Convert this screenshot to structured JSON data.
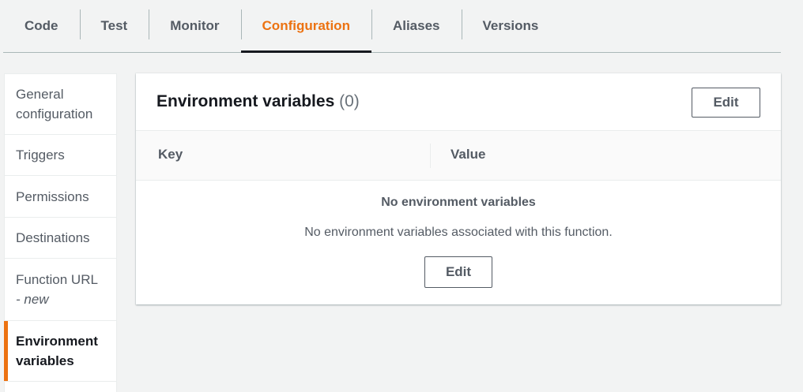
{
  "tabs": [
    {
      "label": "Code"
    },
    {
      "label": "Test"
    },
    {
      "label": "Monitor"
    },
    {
      "label": "Configuration",
      "active": true
    },
    {
      "label": "Aliases"
    },
    {
      "label": "Versions"
    }
  ],
  "sidenav": {
    "items": [
      {
        "label": "General configuration"
      },
      {
        "label": "Triggers"
      },
      {
        "label": "Permissions"
      },
      {
        "label": "Destinations"
      },
      {
        "label": "Function URL",
        "sub": "- new"
      },
      {
        "label": "Environment variables",
        "active": true
      }
    ]
  },
  "panel": {
    "title": "Environment variables",
    "count": "(0)",
    "edit_label": "Edit",
    "columns": {
      "key": "Key",
      "value": "Value"
    },
    "empty": {
      "title": "No environment variables",
      "description": "No environment variables associated with this function.",
      "edit_label": "Edit"
    }
  },
  "colors": {
    "accent": "#ec7211",
    "text": "#16191f",
    "muted": "#545b64",
    "background": "#f2f3f3"
  }
}
